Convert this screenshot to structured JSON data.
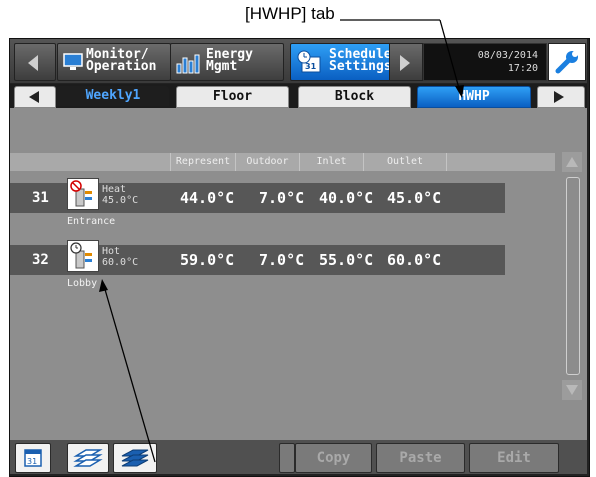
{
  "annotations": {
    "tab_callout": "[HWHP] tab"
  },
  "topbar": {
    "monitor": "Monitor/\nOperation",
    "energy": "Energy\nMgmt",
    "schedule": "Schedule\nSettings",
    "date": "08/03/2014",
    "time": "17:20"
  },
  "tabs": [
    "Weekly1",
    "Floor",
    "Block",
    "HWHP"
  ],
  "columns": [
    "Represent",
    "Outdoor",
    "Inlet",
    "Outlet"
  ],
  "units": [
    {
      "number": "31",
      "mode": "Heat",
      "setpoint": "45.0°C",
      "represent": "44.0°C",
      "outdoor": "7.0°C",
      "inlet": "40.0°C",
      "outlet": "45.0°C",
      "name": "Entrance"
    },
    {
      "number": "32",
      "mode": "Hot",
      "setpoint": "60.0°C",
      "represent": "59.0°C",
      "outdoor": "7.0°C",
      "inlet": "55.0°C",
      "outlet": "60.0°C",
      "name": "Lobby"
    }
  ],
  "bottom": {
    "calendar_day": "31",
    "copy": "Copy",
    "paste": "Paste",
    "edit": "Edit"
  },
  "colors": {
    "accent": "#1a7fe0",
    "panel": "#8e8e8e",
    "row": "#575757"
  }
}
